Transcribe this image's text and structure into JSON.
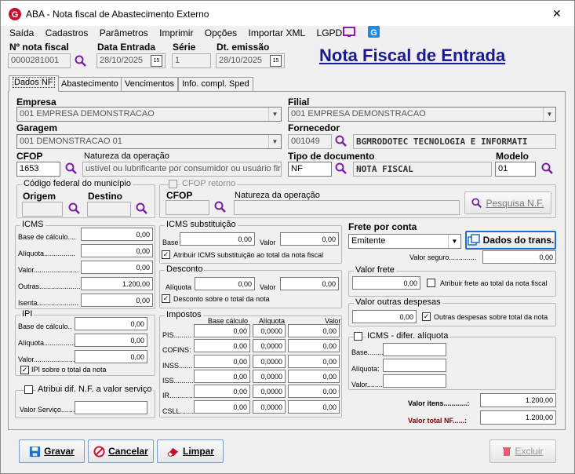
{
  "window": {
    "title": "ABA - Nota fiscal de Abastecimento Externo",
    "close": "✕"
  },
  "menu": [
    "Saída",
    "Cadastros",
    "Parâmetros",
    "Imprimir",
    "Opções",
    "Importar XML",
    "LGPD"
  ],
  "header": {
    "nota_label": "Nº nota fiscal",
    "nota_value": "0000281001",
    "data_entrada_label": "Data Entrada",
    "data_entrada_value": "28/10/2025",
    "serie_label": "Série",
    "serie_value": "1",
    "dt_emissao_label": "Dt. emissão",
    "dt_emissao_value": "28/10/2025",
    "page_title": "Nota Fiscal de Entrada",
    "cal_icon": "15"
  },
  "tabs": [
    "Dados NF",
    "Abastecimento",
    "Vencimentos",
    "Info. compl. Sped"
  ],
  "form": {
    "empresa_label": "Empresa",
    "empresa_value": "001 EMPRESA DEMONSTRACAO",
    "filial_label": "Filial",
    "filial_value": "001 EMPRESA DEMONSTRACAO",
    "garagem_label": "Garagem",
    "garagem_value": "001 DEMONSTRACAO 01",
    "fornecedor_label": "Fornecedor",
    "fornecedor_code": "001049",
    "fornecedor_name": "BGMRODOTEC TECNOLOGIA E INFORMATI",
    "cfop_label": "CFOP",
    "cfop_value": "1653",
    "natureza_label": "Natureza da operação",
    "natureza_value": "ustível ou lubrificante por consumidor ou usuário final",
    "tipo_doc_label": "Tipo de documento",
    "tipo_doc_code": "NF",
    "tipo_doc_name": "NOTA FISCAL",
    "modelo_label": "Modelo",
    "modelo_value": "01"
  },
  "municipio": {
    "title": "Código federal do município",
    "origem": "Origem",
    "destino": "Destino"
  },
  "cfop_retorno": {
    "title": "CFOP retorno",
    "cfop": "CFOP",
    "natureza": "Natureza da operação",
    "pesquisa": "Pesquisa N.F."
  },
  "icms": {
    "title": "ICMS",
    "rows": [
      {
        "label": "Base de cálculo....",
        "value": "0,00"
      },
      {
        "label": "Alíquota................",
        "value": "0,00"
      },
      {
        "label": "Valor.......................",
        "value": "0,00"
      },
      {
        "label": "Outras.....................",
        "value": "1.200,00"
      },
      {
        "label": "Isenta.....................",
        "value": "0,00"
      }
    ]
  },
  "icms_st": {
    "title": "ICMS substituição",
    "base": "Base",
    "base_value": "0,00",
    "valor": "Valor",
    "valor_value": "0,00",
    "check": "Atribuir ICMS substituição ao total da nota fiscal"
  },
  "desconto": {
    "title": "Desconto",
    "aliquota": "Alíquota",
    "aliquota_value": "0,00",
    "valor": "Valor",
    "valor_value": "0,00",
    "check": "Desconto sobre o total da nota"
  },
  "ipi": {
    "title": "IPI",
    "rows": [
      {
        "label": "Base de cálculo..",
        "value": "0,00"
      },
      {
        "label": "Alíquota................",
        "value": "0,00"
      },
      {
        "label": "Valor.......................",
        "value": "0,00"
      }
    ],
    "check": "IPI sobre o total da nota"
  },
  "atribui": {
    "check": "Atribui dif. N.F. a valor serviço",
    "servico": "Valor Serviço........"
  },
  "impostos": {
    "title": "Impostos",
    "col1": "Base cálculo",
    "col2": "Alíquota",
    "col3": "Valor",
    "rows": [
      {
        "label": "PIS.........",
        "base": "0,00",
        "aliq": "0,0000",
        "valor": "0,00"
      },
      {
        "label": "COFINS:",
        "base": "0,00",
        "aliq": "0,0000",
        "valor": "0,00"
      },
      {
        "label": "INSS.......",
        "base": "0,00",
        "aliq": "0,0000",
        "valor": "0,00"
      },
      {
        "label": "ISS..........",
        "base": "0,00",
        "aliq": "0,0000",
        "valor": "0,00"
      },
      {
        "label": "IR.............",
        "base": "0,00",
        "aliq": "0,0000",
        "valor": "0,00"
      },
      {
        "label": "CSLL.......",
        "base": "0,00",
        "aliq": "0,0000",
        "valor": "0,00"
      }
    ]
  },
  "frete": {
    "title": "Frete por conta",
    "value": "Emitente",
    "dados_btn": "Dados do trans.",
    "seguro_label": "Valor seguro..............",
    "seguro_value": "0,00",
    "valor_frete": "Valor frete",
    "valor_frete_value": "0,00",
    "check": "Atribuir frete ao total da nota fiscal"
  },
  "outras": {
    "title": "Valor outras despesas",
    "value": "0,00",
    "check": "Outras despesas sobre total da nota"
  },
  "icms_difer": {
    "title": "ICMS - difer. alíquota",
    "base": "Base........",
    "aliquota": "Alíquota:",
    "valor": "Valor........"
  },
  "totais": {
    "itens_label": "Valor itens............:",
    "itens_value": "1.200,00",
    "total_label": "Valor total NF......:",
    "total_value": "1.200,00"
  },
  "buttons": {
    "gravar": "Gravar",
    "cancelar": "Cancelar",
    "limpar": "Limpar",
    "excluir": "Excluir"
  },
  "colors": {
    "accent": "#1a1a8c",
    "total_label": "#800000",
    "logo": "#c8102e"
  }
}
